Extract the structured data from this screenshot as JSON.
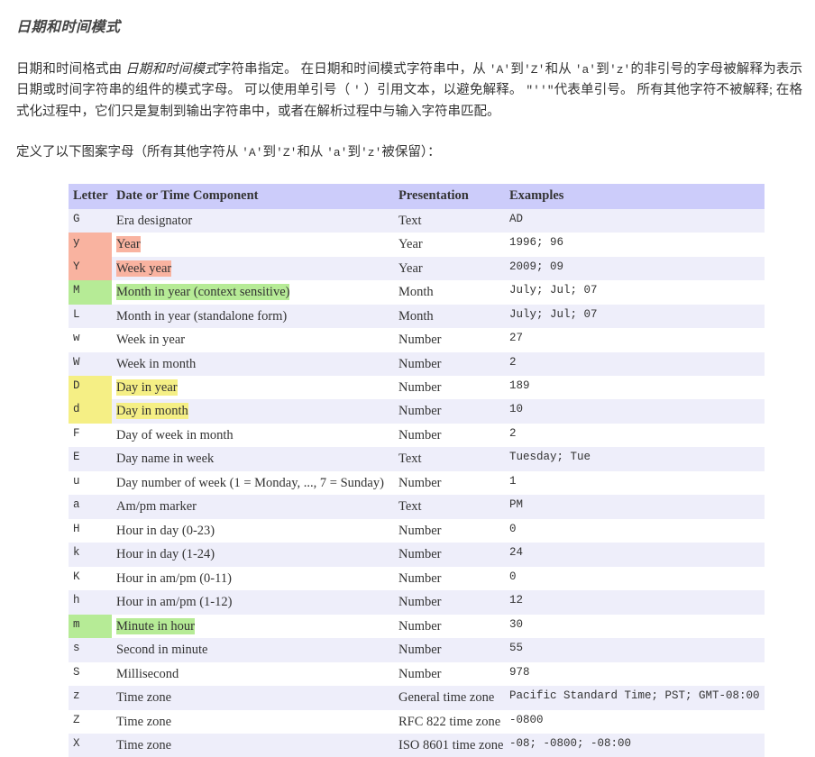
{
  "document": {
    "title": "日期和时间模式",
    "intro_paragraph_parts": {
      "p1_a": "日期和时间格式由 ",
      "p1_italic": "日期和时间模式",
      "p1_b": "字符串指定。 在日期和时间模式字符串中，从 ",
      "p1_q1": "'A'",
      "p1_c": "到",
      "p1_q2": "'Z'",
      "p1_d": "和从 ",
      "p1_q3": "'a'",
      "p1_e": "到",
      "p1_q4": "'z'",
      "p1_f": "的非引号的字母被解释为表示日期或时间字符串的组件的模式字母。 可以使用单引号（ ",
      "p1_q5": "'",
      "p1_g": " ）引用文本，以避免解释。 ",
      "p1_q6": "\"''\"",
      "p1_h": "代表单引号。 所有其他字符不被解释; 在格式化过程中，它们只是复制到输出字符串中，或者在解析过程中与输入字符串匹配。"
    },
    "intro2_parts": {
      "a": "定义了以下图案字母（所有其他字符从 ",
      "q1": "'A'",
      "b": "到",
      "q2": "'Z'",
      "c": "和从 ",
      "q3": "'a'",
      "d": "到",
      "q4": "'z'",
      "e": "被保留）："
    }
  },
  "table": {
    "headers": {
      "letter": "Letter",
      "component": "Date or Time Component",
      "presentation": "Presentation",
      "examples": "Examples"
    },
    "rows": [
      {
        "letter": "G",
        "component": "Era designator",
        "presentation": "Text",
        "examples": "AD",
        "highlight": "none"
      },
      {
        "letter": "y",
        "component": "Year",
        "presentation": "Year",
        "examples": "1996; 96",
        "highlight": "pink"
      },
      {
        "letter": "Y",
        "component": "Week year",
        "presentation": "Year",
        "examples": "2009; 09",
        "highlight": "pink"
      },
      {
        "letter": "M",
        "component": "Month in year (context sensitive)",
        "presentation": "Month",
        "examples": "July; Jul; 07",
        "highlight": "green"
      },
      {
        "letter": "L",
        "component": "Month in year (standalone form)",
        "presentation": "Month",
        "examples": "July; Jul; 07",
        "highlight": "none"
      },
      {
        "letter": "w",
        "component": "Week in year",
        "presentation": "Number",
        "examples": "27",
        "highlight": "none"
      },
      {
        "letter": "W",
        "component": "Week in month",
        "presentation": "Number",
        "examples": "2",
        "highlight": "none"
      },
      {
        "letter": "D",
        "component": "Day in year",
        "presentation": "Number",
        "examples": "189",
        "highlight": "yellow"
      },
      {
        "letter": "d",
        "component": "Day in month",
        "presentation": "Number",
        "examples": "10",
        "highlight": "yellow"
      },
      {
        "letter": "F",
        "component": "Day of week in month",
        "presentation": "Number",
        "examples": "2",
        "highlight": "none"
      },
      {
        "letter": "E",
        "component": "Day name in week",
        "presentation": "Text",
        "examples": "Tuesday; Tue",
        "highlight": "none"
      },
      {
        "letter": "u",
        "component": "Day number of week (1 = Monday, ..., 7 = Sunday)",
        "presentation": "Number",
        "examples": "1",
        "highlight": "none"
      },
      {
        "letter": "a",
        "component": "Am/pm marker",
        "presentation": "Text",
        "examples": "PM",
        "highlight": "none"
      },
      {
        "letter": "H",
        "component": "Hour in day (0-23)",
        "presentation": "Number",
        "examples": "0",
        "highlight": "none"
      },
      {
        "letter": "k",
        "component": "Hour in day (1-24)",
        "presentation": "Number",
        "examples": "24",
        "highlight": "none"
      },
      {
        "letter": "K",
        "component": "Hour in am/pm (0-11)",
        "presentation": "Number",
        "examples": "0",
        "highlight": "none"
      },
      {
        "letter": "h",
        "component": "Hour in am/pm (1-12)",
        "presentation": "Number",
        "examples": "12",
        "highlight": "none"
      },
      {
        "letter": "m",
        "component": "Minute in hour",
        "presentation": "Number",
        "examples": "30",
        "highlight": "green"
      },
      {
        "letter": "s",
        "component": "Second in minute",
        "presentation": "Number",
        "examples": "55",
        "highlight": "none"
      },
      {
        "letter": "S",
        "component": "Millisecond",
        "presentation": "Number",
        "examples": "978",
        "highlight": "none"
      },
      {
        "letter": "z",
        "component": "Time zone",
        "presentation": "General time zone",
        "examples": "Pacific Standard Time; PST; GMT-08:00",
        "highlight": "none"
      },
      {
        "letter": "Z",
        "component": "Time zone",
        "presentation": "RFC 822 time zone",
        "examples": "-0800",
        "highlight": "none"
      },
      {
        "letter": "X",
        "component": "Time zone",
        "presentation": "ISO 8601 time zone",
        "examples": "-08; -0800; -08:00",
        "highlight": "none"
      }
    ]
  },
  "colors": {
    "header_bg": "#ccccfa",
    "stripe_bg": "#eeeefa",
    "highlight_pink": "#f9b3a0",
    "highlight_green": "#b6eb96",
    "highlight_yellow": "#f5ef85",
    "text": "#333333"
  }
}
